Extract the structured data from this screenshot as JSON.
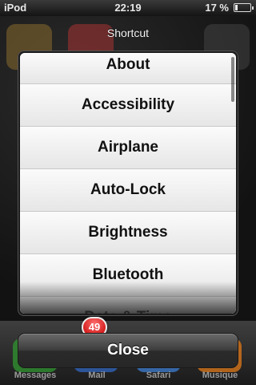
{
  "status_bar": {
    "carrier": "iPod",
    "time": "22:19",
    "battery_percent": "17 %",
    "battery_level": 0.17
  },
  "sheet": {
    "title": "Shortcut",
    "items": [
      "About",
      "Accessibility",
      "Airplane",
      "Auto-Lock",
      "Brightness",
      "Bluetooth",
      "Date & Time"
    ],
    "close_label": "Close"
  },
  "dock": {
    "labels": [
      "Messages",
      "Mail",
      "Safari",
      "Musique"
    ],
    "mail_badge": "49"
  },
  "colors": {
    "dock_messages": "#2f8f2f",
    "dock_mail": "#2f62b7",
    "dock_safari": "#3b78c8",
    "dock_music": "#d5741a"
  }
}
